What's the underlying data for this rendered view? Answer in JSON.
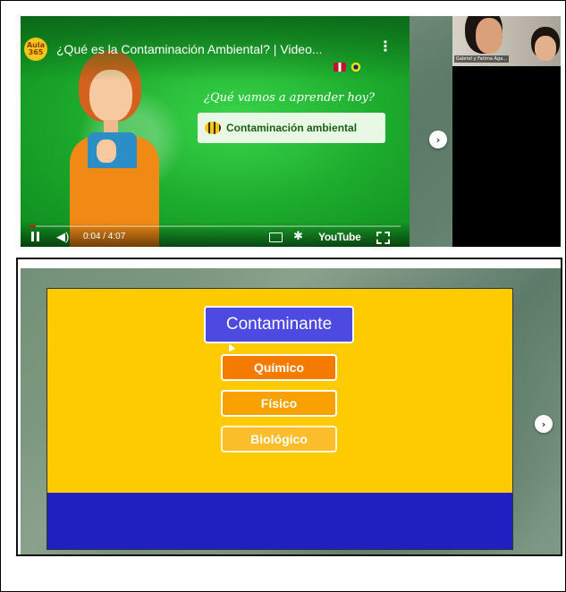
{
  "video": {
    "channel_badge": "Aula 365",
    "title": "¿Qué es la Contaminación Ambiental? | Video...",
    "subtitle": "¿Qué vamos a aprender hoy?",
    "topic": "Contaminación ambiental",
    "time": "0:04 / 4:07",
    "progress": 0.016,
    "brand": "YouTube",
    "icons": [
      "pause-icon",
      "volume-icon",
      "captions-icon",
      "gear-icon",
      "fullscreen-icon",
      "more-icon"
    ]
  },
  "participants": {
    "name_tag": "Gabriel y Fatima Aga..."
  },
  "navigation": {
    "next": "›"
  },
  "slide": {
    "header": "Contaminante",
    "options": [
      "Químico",
      "Físico",
      "Biológico"
    ],
    "colors": {
      "top": "#fdcb00",
      "bottom": "#2020c0",
      "header": "#4c4ae0"
    }
  }
}
